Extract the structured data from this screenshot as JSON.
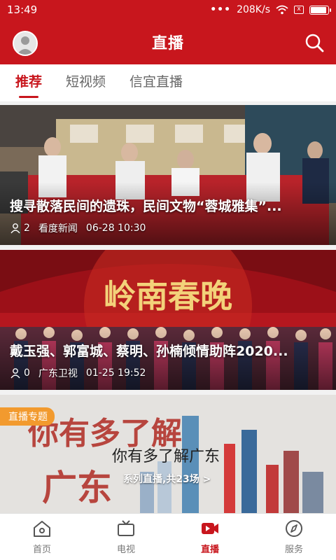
{
  "status": {
    "time": "13:49",
    "dots": "•••",
    "speed": "208K/s",
    "sim_label": "x",
    "battery_level": 0.85
  },
  "header": {
    "title": "直播"
  },
  "tabs": [
    {
      "label": "推荐",
      "active": true
    },
    {
      "label": "短视频",
      "active": false
    },
    {
      "label": "信宜直播",
      "active": false
    }
  ],
  "cards": [
    {
      "title": "搜寻散落民间的遗珠，民间文物“蓉城雅集”...",
      "views": "2",
      "source": "看度新闻",
      "time": "06-28 10:30"
    },
    {
      "title": "戴玉强、郭富城、蔡明、孙楠倾情助阵2020...",
      "views": "0",
      "source": "广东卫视",
      "time": "01-25 19:52"
    }
  ],
  "special": {
    "badge": "直播专题",
    "title": "你有多了解广东",
    "subtitle": "系列直播,共23场 >"
  },
  "bottom_nav": [
    {
      "label": "首页",
      "icon": "home-icon",
      "active": false
    },
    {
      "label": "电视",
      "icon": "tv-icon",
      "active": false
    },
    {
      "label": "直播",
      "icon": "live-icon",
      "active": true
    },
    {
      "label": "服务",
      "icon": "compass-icon",
      "active": false
    }
  ],
  "colors": {
    "brand_red": "#c8161d",
    "badge_orange": "#f29a2e"
  }
}
